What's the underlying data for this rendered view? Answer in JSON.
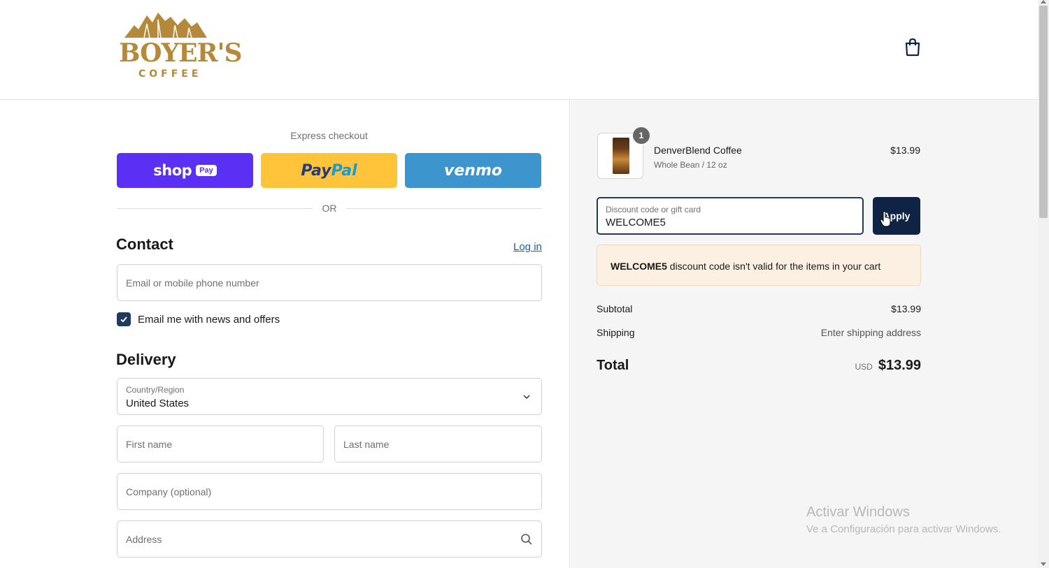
{
  "brand": {
    "name": "BOYER'S",
    "subtitle": "COFFEE"
  },
  "header": {
    "cart_icon": "shopping-bag-icon"
  },
  "express": {
    "label": "Express checkout",
    "shop_pay": {
      "text": "shop",
      "badge": "Pay"
    },
    "paypal": {
      "part1": "Pay",
      "part2": "Pal"
    },
    "venmo": {
      "text": "venmo"
    },
    "or_label": "OR"
  },
  "contact": {
    "heading": "Contact",
    "login_link": "Log in",
    "email_placeholder": "Email or mobile phone number",
    "newsletter_label": "Email me with news and offers",
    "newsletter_checked": true
  },
  "delivery": {
    "heading": "Delivery",
    "country_label": "Country/Region",
    "country_value": "United States",
    "first_name_placeholder": "First name",
    "last_name_placeholder": "Last name",
    "company_placeholder": "Company (optional)",
    "address_placeholder": "Address"
  },
  "summary": {
    "item": {
      "quantity": "1",
      "name": "DenverBlend Coffee",
      "variant": "Whole Bean / 12 oz",
      "price": "$13.99"
    },
    "discount": {
      "label": "Discount code or gift card",
      "value": "WELCOME5",
      "apply_label": "Apply"
    },
    "error": {
      "code": "WELCOME5",
      "message": " discount code isn't valid for the items in your cart"
    },
    "subtotal_label": "Subtotal",
    "subtotal_value": "$13.99",
    "shipping_label": "Shipping",
    "shipping_value": "Enter shipping address",
    "total_label": "Total",
    "currency": "USD",
    "total_value": "$13.99"
  },
  "watermark": {
    "line1": "Activar Windows",
    "line2": "Ve a Configuración para activar Windows."
  },
  "colors": {
    "brand_gold": "#b5893a",
    "accent_navy": "#1e3a5f",
    "shop_pay": "#5a31f4",
    "paypal": "#ffc439",
    "venmo": "#3d95ce",
    "error_bg": "#fcf0e3"
  }
}
